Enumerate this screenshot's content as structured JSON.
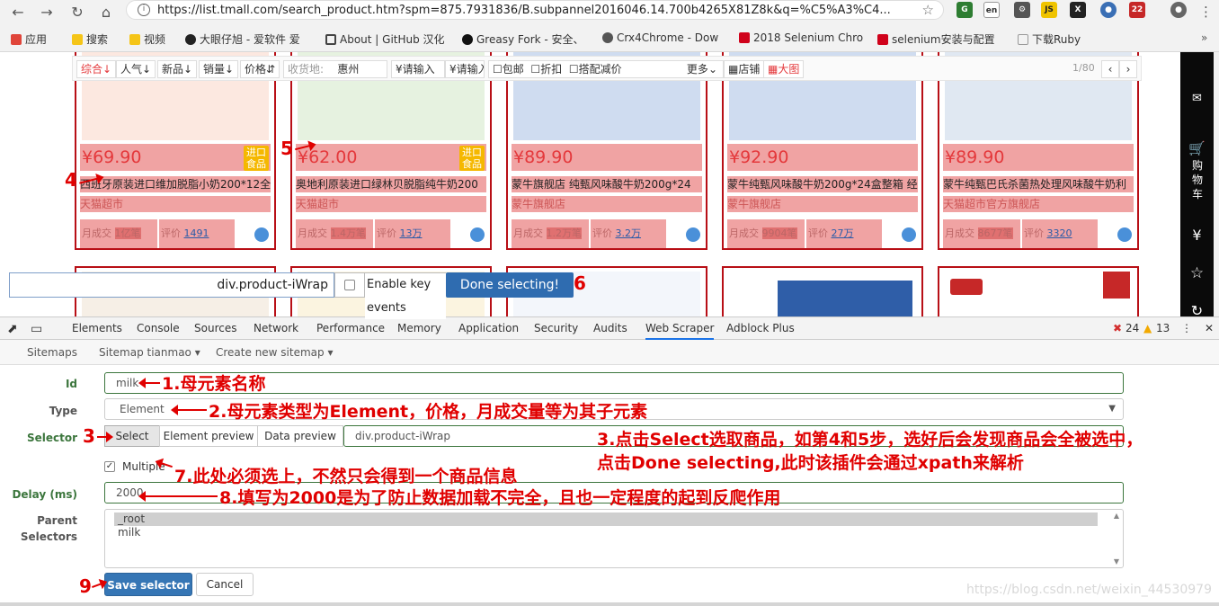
{
  "browser": {
    "url": "https://list.tmall.com/search_product.htm?spm=875.7931836/B.subpannel2016046.14.700b4265X81Z8k&q=%C5%A3%C4...",
    "ext_badge": "22"
  },
  "bookmarks": [
    {
      "label": "应用",
      "color": "#e0453a"
    },
    {
      "label": "搜索",
      "color": "#f5c518"
    },
    {
      "label": "视频",
      "color": "#f5c518"
    },
    {
      "label": "大眼仔旭 - 爱软件 爱",
      "color": "#222222"
    },
    {
      "label": "About | GitHub 汉化",
      "color": "#444444"
    },
    {
      "label": "Greasy Fork - 安全、",
      "color": "#111111"
    },
    {
      "label": "Crx4Chrome - Dow",
      "color": "#555555"
    },
    {
      "label": "2018 Selenium Chro",
      "color": "#d0021b"
    },
    {
      "label": "selenium安装与配置",
      "color": "#d0021b"
    },
    {
      "label": "下载Ruby",
      "color": "#999999"
    }
  ],
  "filters": {
    "sort": [
      "综合",
      "人气",
      "新品",
      "销量",
      "价格"
    ],
    "ship_label": "收货地:",
    "ship_city": "惠州",
    "price_from": "¥请输入",
    "price_to": "¥请输入",
    "checks": [
      "包邮",
      "折扣",
      "搭配减价"
    ],
    "more": "更多",
    "views": [
      "店铺",
      "大图"
    ],
    "pager": "1/80"
  },
  "products": [
    {
      "price": "69.90",
      "tag": "进口食品",
      "title": "西班牙原装进口维加脱脂小奶200*12全",
      "shop": "天猫超市",
      "monthly_label": "月成交",
      "monthly": "1亿笔",
      "review_label": "评价",
      "reviews": "1491"
    },
    {
      "price": "62.00",
      "tag": "进口食品",
      "title": "奥地利原装进口绿林贝脱脂纯牛奶200",
      "shop": "天猫超市",
      "monthly_label": "月成交",
      "monthly": "1.4万笔",
      "review_label": "评价",
      "reviews": "13万"
    },
    {
      "price": "89.90",
      "tag": "",
      "title": "蒙牛旗舰店 纯甄风味酸牛奶200g*24",
      "shop": "蒙牛旗舰店",
      "monthly_label": "月成交",
      "monthly": "1.2万笔",
      "review_label": "评价",
      "reviews": "3.2万"
    },
    {
      "price": "92.90",
      "tag": "",
      "title": "蒙牛纯甄风味酸牛奶200g*24盒整箱 经",
      "shop": "蒙牛旗舰店",
      "monthly_label": "月成交",
      "monthly": "9904笔",
      "review_label": "评价",
      "reviews": "27万"
    },
    {
      "price": "89.90",
      "tag": "",
      "title": "蒙牛纯甄巴氏杀菌热处理风味酸牛奶利",
      "shop": "天猫超市官方旗舰店",
      "monthly_label": "月成交",
      "monthly": "8677笔",
      "review_label": "评价",
      "reviews": "3320"
    }
  ],
  "sidebar": {
    "cart": "购物车"
  },
  "selector_bar": {
    "value": "div.product-iWrap",
    "enable_key": "Enable key events",
    "done": "Done selecting!"
  },
  "devtools": {
    "tabs": [
      "Elements",
      "Console",
      "Sources",
      "Network",
      "Performance",
      "Memory",
      "Application",
      "Security",
      "Audits",
      "Web Scraper",
      "Adblock Plus"
    ],
    "active_tab": "Web Scraper",
    "errors": "24",
    "warnings": "13"
  },
  "scraper_nav": [
    "Sitemaps",
    "Sitemap tianmao",
    "Create new sitemap"
  ],
  "form": {
    "id_label": "Id",
    "id_value": "milk",
    "type_label": "Type",
    "type_value": "Element",
    "selector_label": "Selector",
    "select_btn": "Select",
    "element_preview": "Element preview",
    "data_preview": "Data preview",
    "selector_value": "div.product-iWrap",
    "multiple_label": "Multiple",
    "delay_label": "Delay (ms)",
    "delay_value": "2000",
    "parent_label_1": "Parent",
    "parent_label_2": "Selectors",
    "parent_options": [
      "_root",
      "milk"
    ],
    "save": "Save selector",
    "cancel": "Cancel"
  },
  "annotations": {
    "a1": "1.母元素名称",
    "a2": "2.母元素类型为Element，价格，月成交量等为其子元素",
    "a3_num": "3",
    "a3_line1": "3.点击Select选取商品，如第4和5步，选好后会发现商品会全被选中，",
    "a3_line2": "点击Done selecting,此时该插件会通过xpath来解析",
    "a4": "4",
    "a5": "5",
    "a6": "6",
    "a7": "7.此处必须选上，不然只会得到一个商品信息",
    "a8": "8.填写为2000是为了防止数据加载不完全，且也一定程度的起到反爬作用",
    "a9": "9"
  },
  "watermark": "https://blog.csdn.net/weixin_44530979",
  "colors": {
    "accent": "#e4393c",
    "annotation": "#e00000",
    "primary": "#3676b5"
  }
}
